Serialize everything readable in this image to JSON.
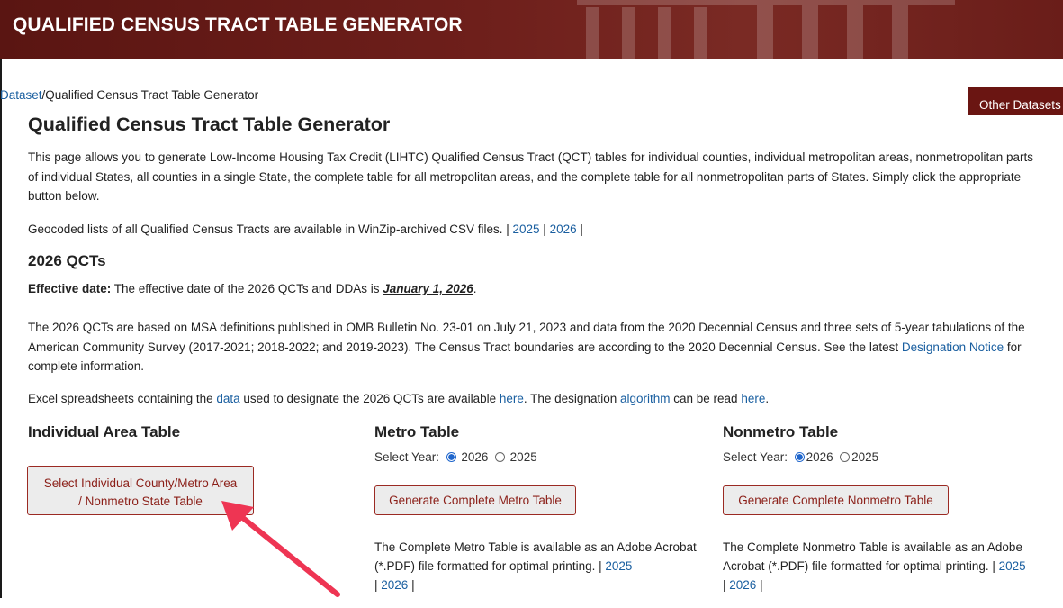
{
  "banner": {
    "title": "QUALIFIED CENSUS TRACT TABLE GENERATOR"
  },
  "breadcrumb": {
    "link": "Dataset",
    "sep": "/",
    "current": "Qualified Census Tract Table Generator"
  },
  "other_datasets_label": "Other Datasets",
  "page_title": "Qualified Census Tract Table Generator",
  "intro": "This page allows you to generate Low-Income Housing Tax Credit (LIHTC) Qualified Census Tract (QCT) tables for individual counties, individual metropolitan areas, nonmetropolitan parts of individual States, all counties in a single State, the complete table for all metropolitan areas, and the complete table for all nonmetropolitan parts of States. Simply click the appropriate button below.",
  "geocoded": {
    "text": "Geocoded lists of all Qualified Census Tracts are available in WinZip-archived CSV files. | ",
    "link_2025": "2025",
    "sep": " | ",
    "link_2026": "2026",
    "tail": " |"
  },
  "qct_heading": "2026 QCTs",
  "effective": {
    "label": "Effective date:",
    "text": " The effective date of the 2026 QCTs and DDAs is ",
    "date": "January 1, 2026",
    "end": "."
  },
  "basis": {
    "text": "The 2026 QCTs are based on MSA definitions published in OMB Bulletin No. 23-01 on July 21, 2023 and data from the 2020 Decennial Census and three sets of 5-year tabulations of the American Community Survey (2017-2021; 2018-2022; and 2019-2023). The Census Tract boundaries are according to the 2020 Decennial Census. See the latest ",
    "link": "Designation Notice",
    "tail": " for complete information."
  },
  "excel": {
    "t1": "Excel spreadsheets containing the ",
    "data_link": "data",
    "t2": " used to designate the 2026 QCTs are available ",
    "here1": "here",
    "t3": ". The designation ",
    "algo_link": "algorithm",
    "t4": " can be read ",
    "here2": "here",
    "t5": "."
  },
  "individual": {
    "heading": "Individual Area Table",
    "button_line1": "Select Individual County/Metro Area",
    "button_line2": "/ Nonmetro State Table"
  },
  "metro": {
    "heading": "Metro Table",
    "select_label": "Select Year:",
    "year_a": "2026",
    "year_b": "2025",
    "selected": "2026",
    "button": "Generate Complete Metro Table",
    "desc": "The Complete Metro Table is available as an Adobe Acrobat (*.PDF) file formatted for optimal printing. | ",
    "link_2025": "2025",
    "sep": "| ",
    "link_2026": "2026",
    "tail": " |"
  },
  "nonmetro": {
    "heading": "Nonmetro Table",
    "select_label": "Select Year:",
    "year_a": "2026",
    "year_b": "2025",
    "selected": "2026",
    "button": "Generate Complete Nonmetro Table",
    "desc": "The Complete Nonmetro Table is available as an Adobe Acrobat (*.PDF) file formatted for optimal printing. | ",
    "link_2025": "2025",
    "sep": "| ",
    "link_2026": "2026",
    "tail": " |"
  },
  "colors": {
    "banner": "#6e1f1b",
    "accent": "#8b1f18",
    "link": "#1a5fa0",
    "arrow": "#ee3553"
  }
}
